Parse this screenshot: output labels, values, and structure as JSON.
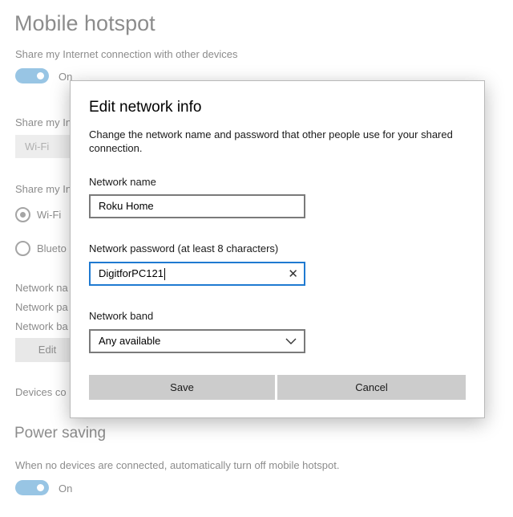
{
  "background": {
    "title": "Mobile hotspot",
    "share_desc": "Share my Internet connection with other devices",
    "toggle_label": "On",
    "share_from_label": "Share my In",
    "share_from_value": "Wi-Fi",
    "share_over_label": "Share my In",
    "radio_wifi": "Wi-Fi",
    "radio_bluetooth": "Blueto",
    "info_name": "Network na",
    "info_password": "Network pa",
    "info_band": "Network ba",
    "edit_button": "Edit",
    "devices_label": "Devices co",
    "power_saving_title": "Power saving",
    "power_saving_desc": "When no devices are connected, automatically turn off mobile hotspot.",
    "power_toggle_label": "On"
  },
  "dialog": {
    "title": "Edit network info",
    "description": "Change the network name and password that other people use for your shared connection.",
    "network_name_label": "Network name",
    "network_name_value": "Roku Home",
    "password_label": "Network password (at least 8 characters)",
    "password_value": "DigitforPC121",
    "band_label": "Network band",
    "band_value": "Any available",
    "save_label": "Save",
    "cancel_label": "Cancel"
  }
}
